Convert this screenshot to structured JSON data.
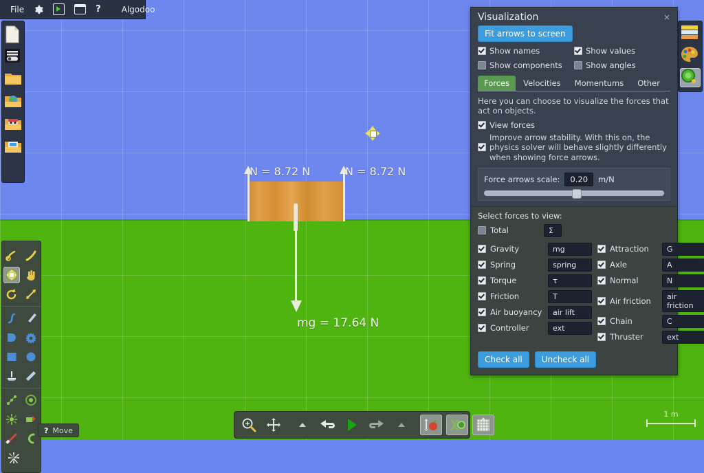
{
  "menubar": {
    "items": [
      {
        "label": "File",
        "icon": "file-menu"
      },
      {
        "label": "",
        "icon": "gear-icon"
      },
      {
        "label": "",
        "icon": "play-box-icon"
      },
      {
        "label": "",
        "icon": "window-icon"
      },
      {
        "label": "?",
        "icon": "help-icon"
      }
    ],
    "app_name": "Algodoo"
  },
  "left_sidebar": {
    "items": [
      {
        "name": "new-scene-icon"
      },
      {
        "name": "scene-options-icon"
      },
      {
        "name": "open-folder-icon"
      },
      {
        "name": "scenes-folder-icon"
      },
      {
        "name": "my-scenes-folder-icon"
      },
      {
        "name": "saved-folder-icon"
      }
    ]
  },
  "right_sidebar": {
    "items": [
      {
        "name": "material-swatches-icon"
      },
      {
        "name": "color-palette-icon"
      },
      {
        "name": "appearance-icon",
        "selected": true
      }
    ]
  },
  "tool_palette": {
    "groups": [
      {
        "tools": [
          {
            "name": "draw-tool",
            "selected": false
          },
          {
            "name": "pen-tool",
            "selected": false
          },
          {
            "name": "move-tool",
            "selected": true
          },
          {
            "name": "drag-hand-tool",
            "selected": false
          },
          {
            "name": "rotate-tool",
            "selected": false
          },
          {
            "name": "scale-tool",
            "selected": false
          }
        ]
      },
      {
        "tools": [
          {
            "name": "spline-tool",
            "selected": false
          },
          {
            "name": "brush-tool",
            "selected": false
          },
          {
            "name": "polygon-tool",
            "selected": false
          },
          {
            "name": "gear-shape-tool",
            "selected": false
          },
          {
            "name": "box-tool",
            "selected": false
          },
          {
            "name": "circle-tool",
            "selected": false
          },
          {
            "name": "fixate-tool",
            "selected": false
          },
          {
            "name": "plane-tool",
            "selected": false
          }
        ]
      },
      {
        "tools": [
          {
            "name": "chain-tool",
            "selected": false
          },
          {
            "name": "axle-tool",
            "selected": false
          },
          {
            "name": "spring-tool",
            "selected": false
          },
          {
            "name": "thruster-tool",
            "selected": false
          },
          {
            "name": "laser-tool",
            "selected": false
          },
          {
            "name": "tracer-tool",
            "selected": false
          },
          {
            "name": "erase-tool",
            "selected": false
          }
        ]
      }
    ]
  },
  "bottom_toolbar": {
    "buttons": [
      {
        "name": "zoom-tool-button"
      },
      {
        "name": "pan-tool-button"
      },
      {
        "name": "step-back-small-button"
      },
      {
        "name": "undo-button"
      },
      {
        "name": "play-button"
      },
      {
        "name": "redo-button"
      },
      {
        "name": "step-forward-small-button"
      },
      {
        "name": "gravity-toggle-button"
      },
      {
        "name": "collision-toggle-button"
      },
      {
        "name": "grid-toggle-button"
      }
    ]
  },
  "status_tip": {
    "icon": "help-icon",
    "label": "Move"
  },
  "scene": {
    "scale_bar_label": "1 m",
    "force_labels": [
      {
        "name": "normal-force-left",
        "text": "N = 8.72 N"
      },
      {
        "name": "normal-force-right",
        "text": "N = 8.72 N"
      },
      {
        "name": "gravity-force",
        "text": "mg = 17.64 N"
      }
    ]
  },
  "visualization": {
    "title": "Visualization",
    "close_label": "×",
    "fit_arrows_label": "Fit arrows to screen",
    "display_options": [
      {
        "label": "Show names",
        "checked": true
      },
      {
        "label": "Show values",
        "checked": true
      },
      {
        "label": "Show components",
        "checked": false
      },
      {
        "label": "Show angles",
        "checked": false
      }
    ],
    "tabs": [
      {
        "label": "Forces",
        "active": true
      },
      {
        "label": "Velocities",
        "active": false
      },
      {
        "label": "Momentums",
        "active": false
      },
      {
        "label": "Other",
        "active": false
      }
    ],
    "description": "Here you can choose to visualize the forces that act on objects.",
    "view_forces": {
      "label": "View forces",
      "checked": true
    },
    "stability": {
      "label": "Improve arrow stability. With this on, the physics solver will behave slightly differently when showing force arrows.",
      "checked": true
    },
    "force_scale": {
      "label": "Force arrows scale:",
      "value": "0.20",
      "unit": "m/N",
      "knob_percent": 49
    },
    "select_header": "Select forces to view:",
    "total": {
      "label": "Total",
      "tag": "Σ",
      "checked": false
    },
    "forces_left": [
      {
        "label": "Gravity",
        "tag": "mg",
        "checked": true
      },
      {
        "label": "Spring",
        "tag": "spring",
        "checked": true
      },
      {
        "label": "Torque",
        "tag": "τ",
        "checked": true
      },
      {
        "label": "Friction",
        "tag": "T",
        "checked": true
      },
      {
        "label": "Air buoyancy",
        "tag": "air lift",
        "checked": true
      },
      {
        "label": "Controller",
        "tag": "ext",
        "checked": true
      }
    ],
    "forces_right": [
      {
        "label": "Attraction",
        "tag": "G",
        "checked": true
      },
      {
        "label": "Axle",
        "tag": "A",
        "checked": true
      },
      {
        "label": "Normal",
        "tag": "N",
        "checked": true
      },
      {
        "label": "Air friction",
        "tag": "air friction",
        "checked": true
      },
      {
        "label": "Chain",
        "tag": "C",
        "checked": true
      },
      {
        "label": "Thruster",
        "tag": "ext",
        "checked": true
      }
    ],
    "check_all_label": "Check all",
    "uncheck_all_label": "Uncheck all"
  },
  "colors": {
    "sky": "#6d87ee",
    "ground": "#4fb410",
    "panel": "#39414e",
    "accent_blue": "#3b9ddd",
    "tab_green": "#5a9a50",
    "box_wood": "#d58f33"
  }
}
